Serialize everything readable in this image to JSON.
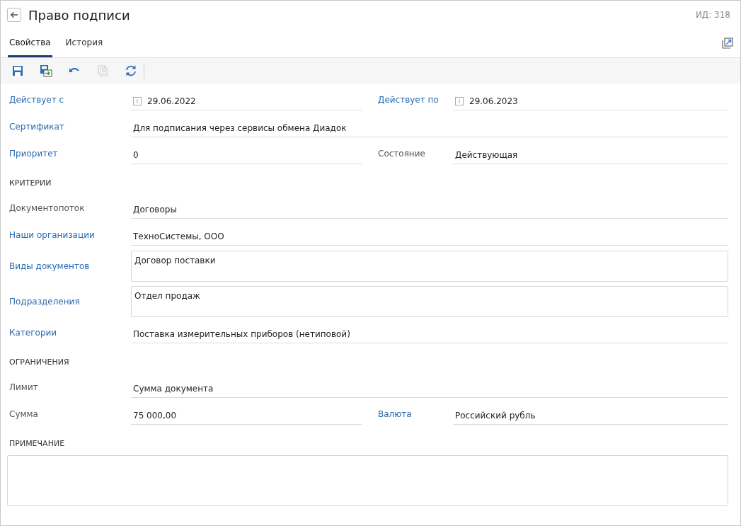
{
  "header": {
    "title": "Право подписи",
    "id_label": "ИД: 318"
  },
  "tabs": [
    {
      "label": "Свойства",
      "selected": true
    },
    {
      "label": "История",
      "selected": false
    }
  ],
  "toolbar": [
    {
      "kind": "save",
      "disabled": false
    },
    {
      "kind": "save-as",
      "disabled": false
    },
    {
      "kind": "undo",
      "disabled": false
    },
    {
      "kind": "copy",
      "disabled": true
    },
    {
      "kind": "refresh",
      "disabled": false
    }
  ],
  "sections": [
    {
      "rows": [
        [
          {
            "label": "Действует с",
            "link": true,
            "kind": "date",
            "value": "29.06.2022"
          },
          {
            "label": "Действует по",
            "link": true,
            "kind": "date",
            "value": "29.06.2023"
          }
        ],
        [
          {
            "label": "Сертификат",
            "link": true,
            "kind": "text",
            "value": "Для подписания через сервисы обмена Диадок"
          }
        ],
        [
          {
            "label": "Приоритет",
            "link": true,
            "kind": "text",
            "value": "0"
          },
          {
            "label": "Состояние",
            "link": false,
            "kind": "text",
            "value": "Действующая"
          }
        ]
      ]
    },
    {
      "heading": "КРИТЕРИИ",
      "rows": [
        [
          {
            "label": "Документопоток",
            "link": false,
            "kind": "text",
            "value": "Договоры"
          }
        ],
        [
          {
            "label": "Наши организации",
            "link": true,
            "kind": "text",
            "value": "ТехноСистемы, ООО"
          }
        ],
        [
          {
            "label": "Виды документов",
            "link": true,
            "kind": "multiline",
            "value": "Договор поставки"
          }
        ],
        [
          {
            "label": "Подразделения",
            "link": true,
            "kind": "multiline",
            "value": "Отдел продаж"
          }
        ],
        [
          {
            "label": "Категории",
            "link": true,
            "kind": "text",
            "value": "Поставка измерительных приборов (нетиповой)"
          }
        ]
      ]
    },
    {
      "heading": "ОГРАНИЧЕНИЯ",
      "rows": [
        [
          {
            "label": "Лимит",
            "link": false,
            "kind": "text",
            "value": "Сумма документа"
          }
        ],
        [
          {
            "label": "Сумма",
            "link": false,
            "kind": "text",
            "value": "75 000,00"
          },
          {
            "label": "Валюта",
            "link": true,
            "kind": "text",
            "value": "Российский рубль"
          }
        ]
      ]
    }
  ],
  "note": {
    "heading": "ПРИМЕЧАНИЕ"
  }
}
